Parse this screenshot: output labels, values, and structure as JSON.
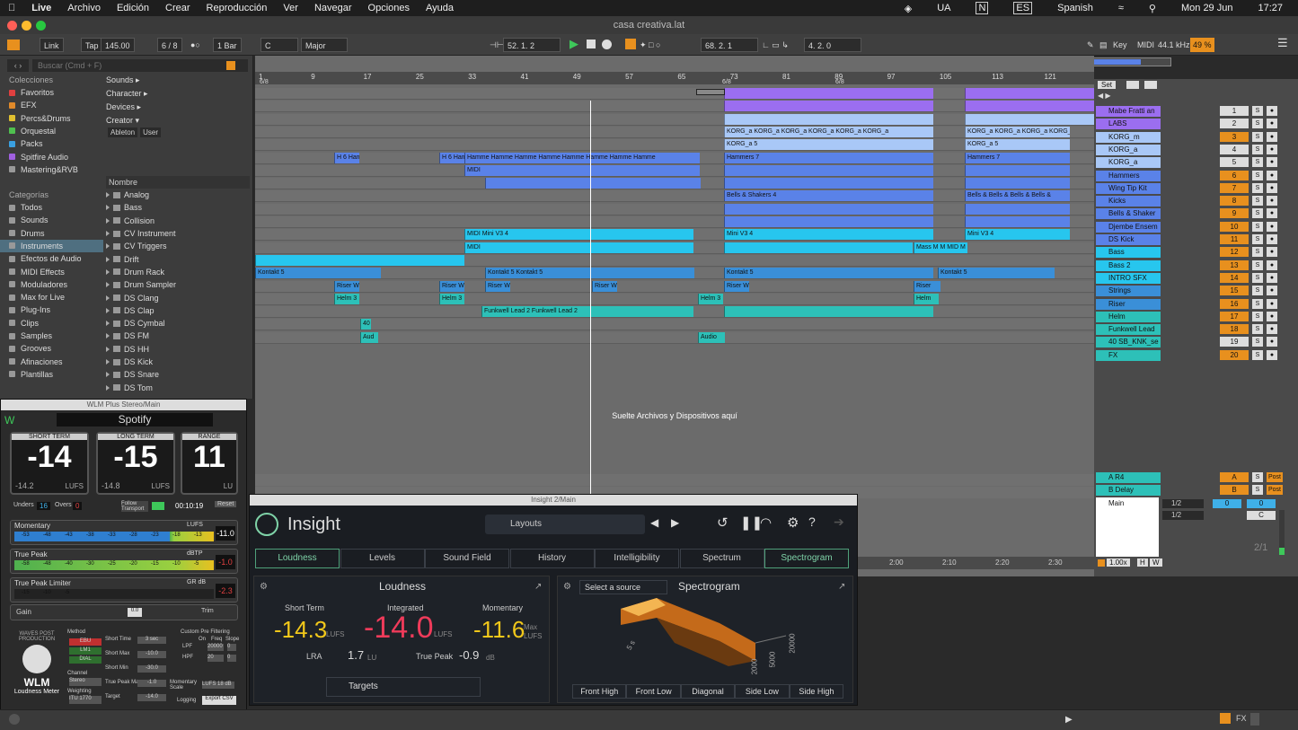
{
  "menubar": {
    "app": "Live",
    "items": [
      "Archivo",
      "Edición",
      "Crear",
      "Reproducción",
      "Ver",
      "Navegar",
      "Opciones",
      "Ayuda"
    ],
    "right": [
      "UA",
      "N",
      "ES",
      "Spanish",
      "Mon 29 Jun",
      "17:27"
    ]
  },
  "window": {
    "title": "casa creativa.lat"
  },
  "toolbar": {
    "link": "Link",
    "tap": "Tap",
    "tempo": "145.00",
    "sig": "6 / 8",
    "quant": "1 Bar",
    "key": "C",
    "scale": "Major",
    "pos": "52. 1. 2",
    "loop_start": "68. 2. 1",
    "loop_len": "4. 2. 0",
    "key_btn": "Key",
    "midi_btn": "MIDI",
    "sample_rate": "44.1 kHz",
    "cpu": "49 %"
  },
  "browser": {
    "search_placeholder": "Buscar (Cmd + F)",
    "collections_title": "Colecciones",
    "collections": [
      {
        "label": "Favoritos",
        "color": "#e04040"
      },
      {
        "label": "EFX",
        "color": "#e08a2a"
      },
      {
        "label": "Percs&Drums",
        "color": "#e0c030"
      },
      {
        "label": "Orquestal",
        "color": "#4fc04f"
      },
      {
        "label": "Packs",
        "color": "#3aa0e0"
      },
      {
        "label": "Spitfire Audio",
        "color": "#a060e0"
      },
      {
        "label": "Mastering&RVB",
        "color": "#999999"
      }
    ],
    "categories_title": "Categorías",
    "categories": [
      "Todos",
      "Sounds",
      "Drums",
      "Instruments",
      "Efectos de Audio",
      "MIDI Effects",
      "Moduladores",
      "Max for Live",
      "Plug-Ins",
      "Clips",
      "Samples",
      "Grooves",
      "Afinaciones",
      "Plantillas"
    ],
    "filters": [
      "Sounds ▸",
      "Character ▸",
      "Devices ▸",
      "Creator ▾"
    ],
    "tags": [
      "Ableton",
      "User"
    ],
    "list_header": "Nombre",
    "list": [
      "Analog",
      "Bass",
      "Collision",
      "CV Instrument",
      "CV Triggers",
      "Drift",
      "Drum Rack",
      "Drum Sampler",
      "DS Clang",
      "DS Clap",
      "DS Cymbal",
      "DS FM",
      "DS HH",
      "DS Kick",
      "DS Snare",
      "DS Tom"
    ]
  },
  "ruler": {
    "bars": [
      "1",
      "9",
      "17",
      "25",
      "33",
      "41",
      "49",
      "57",
      "65",
      "73",
      "81",
      "89",
      "97",
      "105",
      "113",
      "121"
    ],
    "sig_a": "6/8",
    "sig_b": "6/8",
    "sig_c": "6/8",
    "times": [
      "2:00",
      "2:10",
      "2:20",
      "2:30"
    ]
  },
  "drop_text": "Suelte Archivos y Dispositivos aquí",
  "tracks": [
    {
      "name": "Mabe Fratti an",
      "num": "1",
      "color": "#9b6ef0",
      "clips": [
        [
          522,
          233,
          ""
        ],
        [
          790,
          233,
          ""
        ]
      ]
    },
    {
      "name": "LABS",
      "num": "2",
      "color": "#9b6ef0",
      "clips": [
        [
          522,
          233,
          ""
        ],
        [
          790,
          233,
          ""
        ]
      ]
    },
    {
      "name": "KORG_m",
      "num": "3",
      "color": "#a9c8f7",
      "clips": [
        [
          522,
          233,
          ""
        ],
        [
          790,
          233,
          ""
        ]
      ]
    },
    {
      "name": "KORG_a",
      "num": "4",
      "color": "#a9c8f7",
      "clips": [
        [
          522,
          233,
          "KORG_a KORG_a KORG_a KORG_a KORG_a KORG_a"
        ],
        [
          790,
          117,
          "KORG_a KORG_a KORG_a KORG_a"
        ]
      ]
    },
    {
      "name": "KORG_a",
      "num": "5",
      "color": "#a9c8f7",
      "clips": [
        [
          522,
          233,
          "KORG_a 5"
        ],
        [
          790,
          117,
          "KORG_a 5"
        ]
      ]
    },
    {
      "name": "Hammers",
      "num": "6",
      "color": "#5a82e8",
      "clips": [
        [
          88,
          28,
          "H 6 Ham"
        ],
        [
          205,
          48,
          "H 6 Ham Hamr"
        ],
        [
          233,
          262,
          "Hamme Hamme Hamme Hamme Hamme Hamme Hamme Hamme"
        ],
        [
          522,
          233,
          "Hammers 7"
        ],
        [
          790,
          117,
          "Hammers 7"
        ]
      ]
    },
    {
      "name": "Wing Tip Kit",
      "num": "7",
      "color": "#5a82e8",
      "clips": [
        [
          233,
          262,
          "MIDI"
        ],
        [
          522,
          233,
          ""
        ],
        [
          790,
          117,
          ""
        ]
      ]
    },
    {
      "name": "Kicks",
      "num": "8",
      "color": "#5a82e8",
      "clips": [
        [
          256,
          240,
          ""
        ],
        [
          522,
          233,
          ""
        ],
        [
          790,
          117,
          ""
        ]
      ]
    },
    {
      "name": "Bells & Shaker",
      "num": "9",
      "color": "#5a82e8",
      "clips": [
        [
          522,
          233,
          "Bells & Shakers 4"
        ],
        [
          790,
          117,
          "Bells & Bells & Bells & Bells &"
        ]
      ]
    },
    {
      "name": "Djembe Ensem",
      "num": "10",
      "color": "#5a82e8",
      "clips": [
        [
          522,
          233,
          ""
        ],
        [
          790,
          117,
          ""
        ]
      ]
    },
    {
      "name": "DS Kick",
      "num": "11",
      "color": "#5a82e8",
      "clips": [
        [
          522,
          233,
          ""
        ],
        [
          790,
          117,
          ""
        ]
      ]
    },
    {
      "name": "Bass",
      "num": "12",
      "color": "#27c6ee",
      "clips": [
        [
          233,
          255,
          "MIDI Mini V3 4"
        ],
        [
          522,
          233,
          "Mini V3 4"
        ],
        [
          790,
          117,
          "Mini V3 4"
        ]
      ]
    },
    {
      "name": "Bass 2",
      "num": "13",
      "color": "#27c6ee",
      "clips": [
        [
          233,
          255,
          "MIDI"
        ],
        [
          522,
          210,
          ""
        ],
        [
          733,
          60,
          "Mass M M MID M"
        ]
      ]
    },
    {
      "name": "INTRO SFX",
      "num": "14",
      "color": "#27c6ee",
      "clips": [
        [
          0,
          233,
          ""
        ]
      ]
    },
    {
      "name": "Strings",
      "num": "15",
      "color": "#3a8fd8",
      "clips": [
        [
          0,
          140,
          "Kontakt 5"
        ],
        [
          256,
          233,
          "Kontakt 5 Kontakt 5"
        ],
        [
          522,
          233,
          "Kontakt 5"
        ],
        [
          760,
          130,
          "Kontakt 5"
        ]
      ]
    },
    {
      "name": "Riser",
      "num": "16",
      "color": "#3a8fd8",
      "clips": [
        [
          88,
          28,
          "Riser W"
        ],
        [
          205,
          28,
          "Riser W"
        ],
        [
          256,
          28,
          "Riser W"
        ],
        [
          375,
          28,
          "Riser W"
        ],
        [
          522,
          28,
          "Riser W"
        ],
        [
          733,
          30,
          "Riser"
        ]
      ]
    },
    {
      "name": "Helm",
      "num": "17",
      "color": "#2dc0b8",
      "clips": [
        [
          88,
          28,
          "Helm 3"
        ],
        [
          205,
          28,
          "Helm 3"
        ],
        [
          493,
          28,
          "Helm 3"
        ],
        [
          733,
          28,
          "Helm"
        ]
      ]
    },
    {
      "name": "Funkwell Lead",
      "num": "18",
      "color": "#2dc0b8",
      "clips": [
        [
          252,
          236,
          "Funkwell Lead 2 Funkwell Lead 2"
        ],
        [
          522,
          233,
          ""
        ]
      ]
    },
    {
      "name": "40 SB_KNK_se",
      "num": "19",
      "color": "#2dc0b8",
      "clips": [
        [
          117,
          12,
          "40"
        ]
      ]
    },
    {
      "name": "FX",
      "num": "20",
      "color": "#2dc0b8",
      "clips": [
        [
          117,
          20,
          "Aud"
        ],
        [
          493,
          30,
          "Audio"
        ]
      ]
    }
  ],
  "returns": [
    {
      "name": "A R4",
      "letter": "A"
    },
    {
      "name": "B Delay",
      "letter": "B"
    }
  ],
  "master": {
    "name": "Main",
    "route1": "1/2",
    "route2": "1/2",
    "value": "0",
    "label": "C",
    "ratio": "2/1",
    "set_btn": "Set",
    "zoom": "1.00x",
    "h": "H",
    "w": "W",
    "post": "Post",
    "ch": "Ch. 1"
  },
  "wlm": {
    "title": "WLM Plus Stereo/Main",
    "preset": "Spotify",
    "short_term": {
      "label": "SHORT TERM",
      "value": "-14",
      "sub": "-14.2",
      "unit": "LUFS"
    },
    "long_term": {
      "label": "LONG TERM",
      "value": "-15",
      "sub": "-14.8",
      "unit": "LUFS"
    },
    "range": {
      "label": "RANGE",
      "value": "11",
      "unit": "LU"
    },
    "unders": "16",
    "overs": "0",
    "follow": "Follow Transport",
    "time": "00:10:19",
    "reset": "Reset",
    "momentary": {
      "label": "Momentary",
      "unit": "LUFS",
      "value": "-11.0",
      "scale": [
        "-53",
        "-48",
        "-43",
        "-38",
        "-33",
        "-28",
        "-23",
        "-18",
        "-13"
      ]
    },
    "true_peak": {
      "label": "True Peak",
      "unit": "dBTP",
      "value": "-1.0",
      "scale": [
        "-58",
        "-48",
        "-40",
        "-30",
        "-25",
        "-20",
        "-15",
        "-10",
        "-5"
      ]
    },
    "limiter": {
      "label": "True Peak Limiter",
      "unit": "GR dB",
      "value": "-2.3",
      "on": "On",
      "scale": [
        "-15",
        "-10",
        "-5"
      ]
    },
    "gain": {
      "label": "Gain",
      "value": "0.0",
      "trim": "Trim",
      "range": "-18 18"
    },
    "brand": "WAVES POST PRODUCTION",
    "model": "WLM",
    "model_sub": "Loudness Meter",
    "method_label": "Method",
    "methods": [
      "EBU",
      "LM1",
      "DIAL"
    ],
    "channel_label": "Channel",
    "channel": "Stereo",
    "weighting_label": "Weighting",
    "weighting": "ITU 1770",
    "settings": [
      {
        "label": "Short Time",
        "value": "3 sec"
      },
      {
        "label": "Short Max",
        "value": "-10.0"
      },
      {
        "label": "Short Min",
        "value": "-30.0"
      },
      {
        "label": "True Peak Max",
        "value": "-1.0"
      },
      {
        "label": "Target",
        "value": "-14.0"
      }
    ],
    "moscale_label": "Momentary Scale",
    "moscale": "LUFS 18 dB",
    "logging": "Logging",
    "export": "Export CSV",
    "prefilter": "Custom Pre Filtering",
    "pf_on": "On",
    "pf_freq": "Freq",
    "pf_slope": "Slope",
    "lpf": "LPF",
    "lpf_freq": "20000",
    "lpf_slope": "0",
    "hpf": "HPF",
    "hpf_freq": "20",
    "hpf_slope": "0"
  },
  "insight": {
    "title": "Insight 2/Main",
    "brand": "Insight",
    "layouts": "Layouts",
    "tabs": [
      "Loudness",
      "Levels",
      "Sound Field",
      "History",
      "Intelligibility",
      "Spectrum",
      "Spectrogram"
    ],
    "loudness": {
      "title": "Loudness",
      "short_term_label": "Short Term",
      "short_term": "-14.3",
      "integrated_label": "Integrated",
      "integrated": "-14.0",
      "momentary_label": "Momentary",
      "momentary": "-11.6",
      "max_label": "Max",
      "unit": "LUFS",
      "lra_label": "LRA",
      "lra": "1.7",
      "lu": "LU",
      "tp_label": "True Peak",
      "tp": "-0.9",
      "db": "dB",
      "targets": "Targets"
    },
    "spectrogram": {
      "title": "Spectrogram",
      "source": "Select a source",
      "views": [
        "Front High",
        "Front Low",
        "Diagonal",
        "Side Low",
        "Side High"
      ],
      "axis": [
        "20000",
        "5000",
        "2000",
        "5 s"
      ]
    }
  }
}
